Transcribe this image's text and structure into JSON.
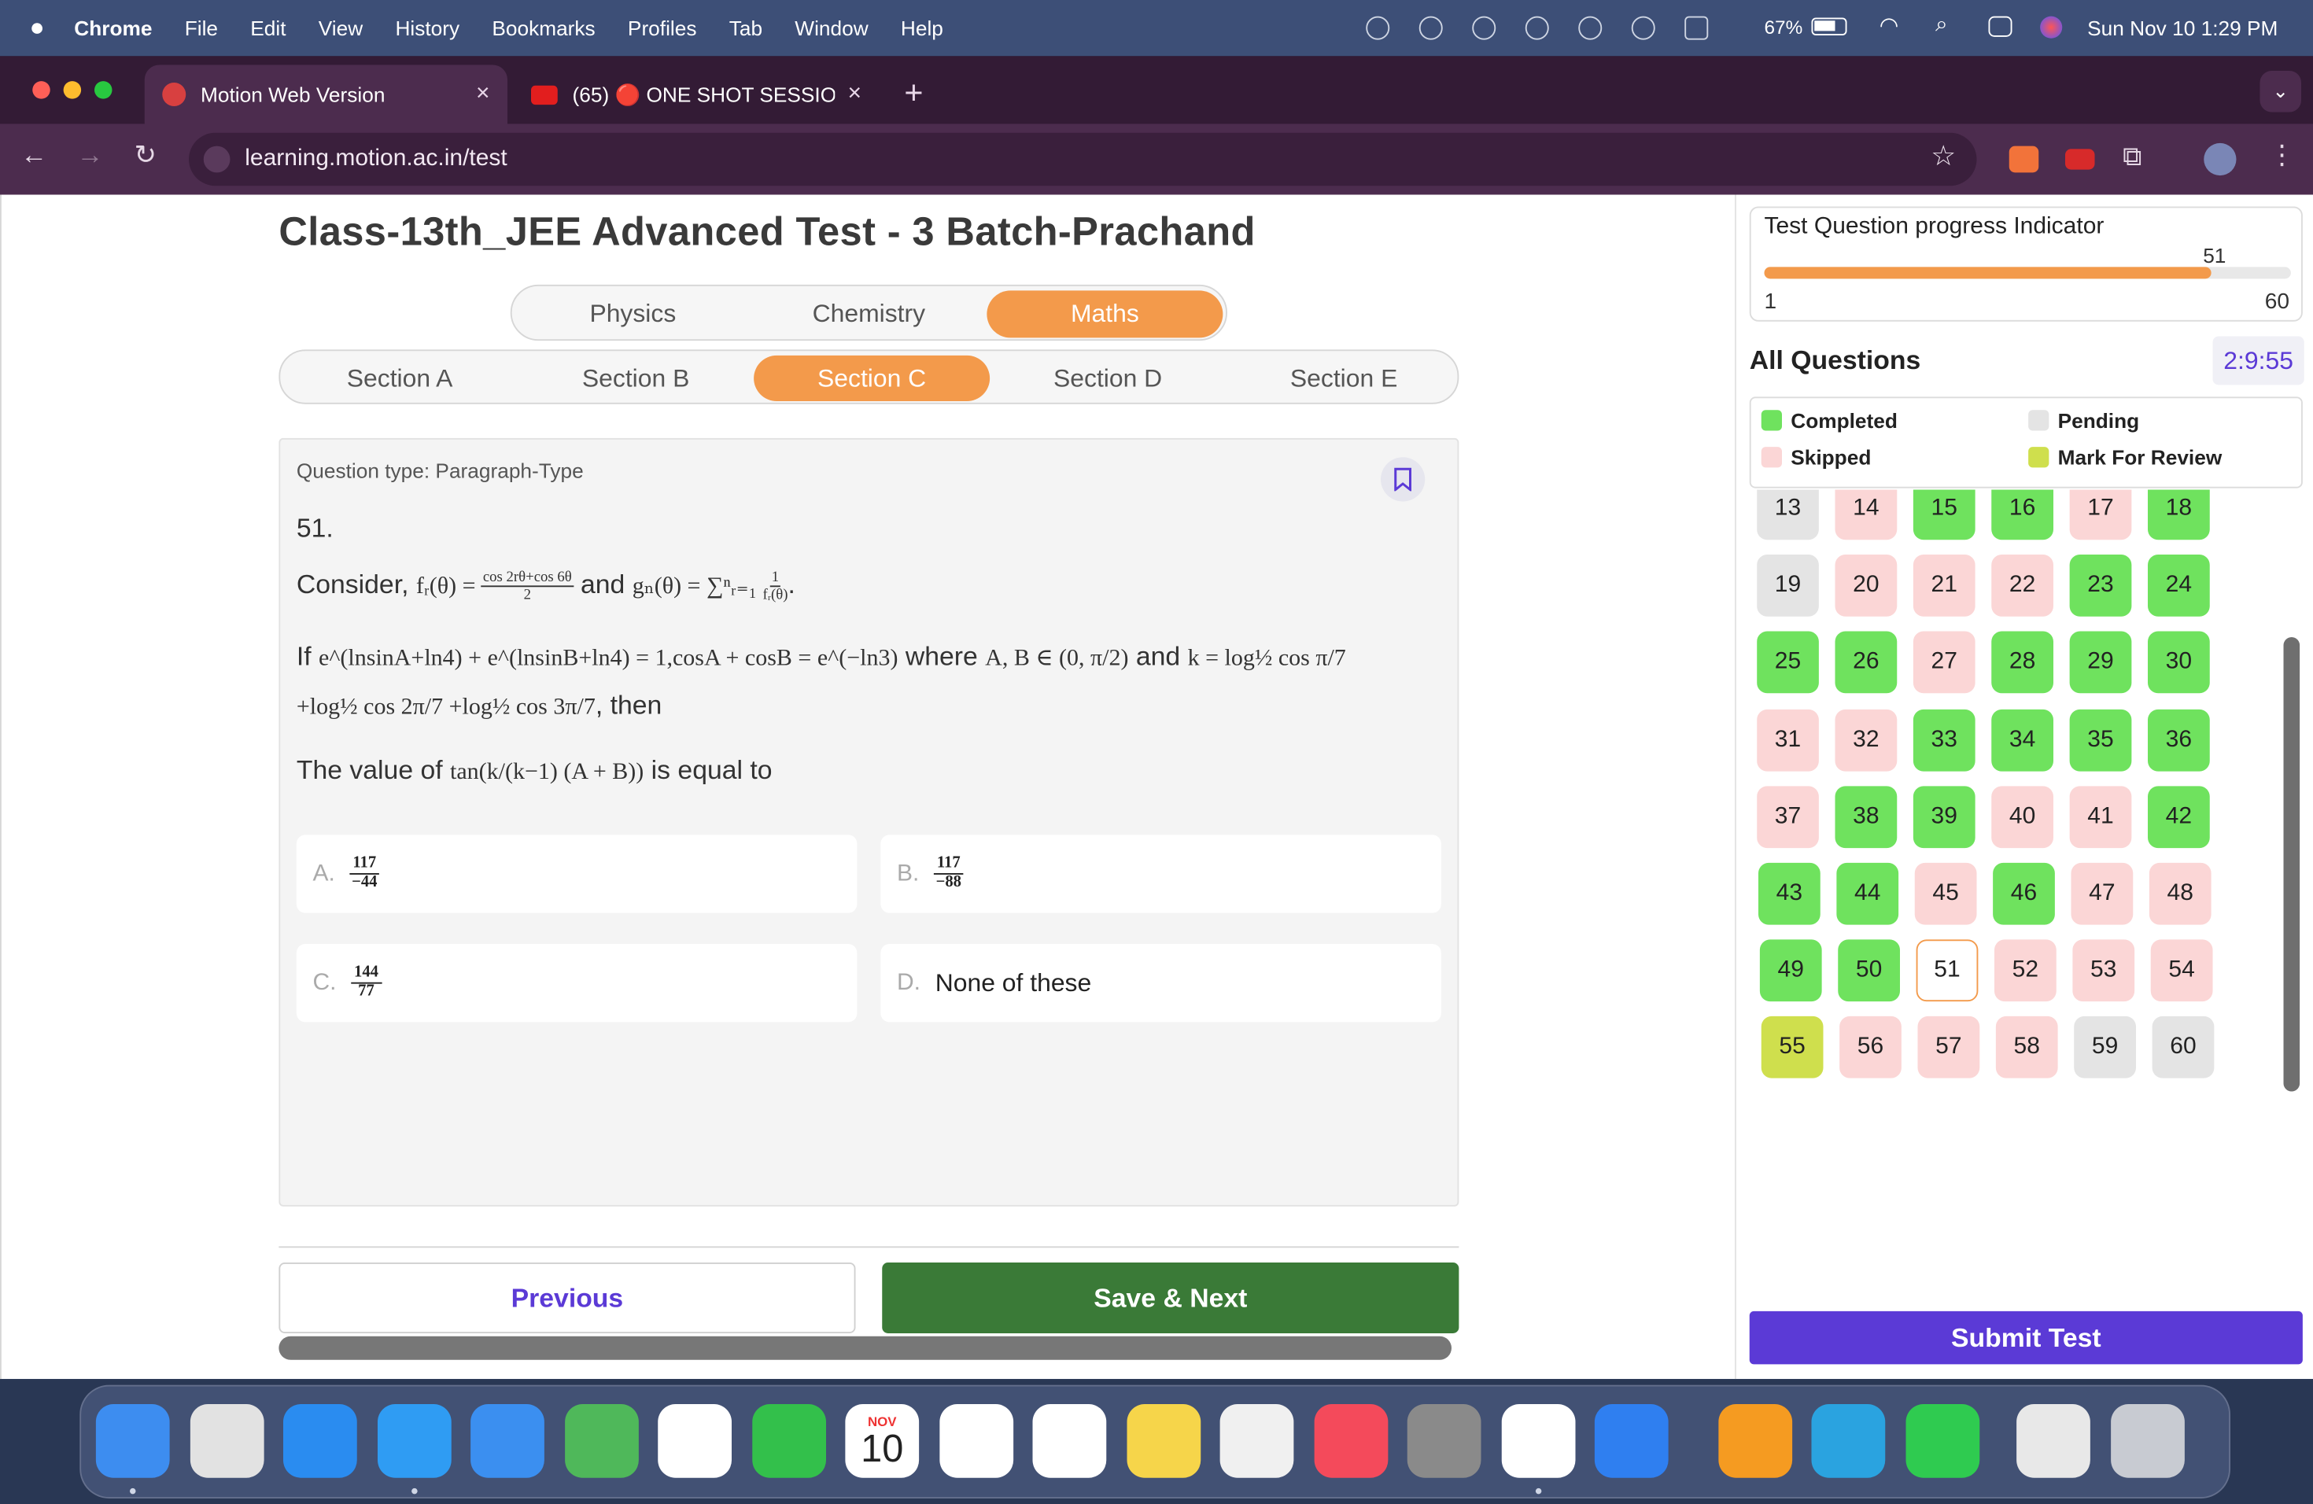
{
  "menubar": {
    "app": "Chrome",
    "items": [
      "File",
      "Edit",
      "View",
      "History",
      "Bookmarks",
      "Profiles",
      "Tab",
      "Window",
      "Help"
    ],
    "battery": "67%",
    "datetime": "Sun Nov 10  1:29 PM"
  },
  "browser": {
    "tabs": [
      {
        "label": "Motion Web Version",
        "active": true
      },
      {
        "label": "(65) 🔴 ONE SHOT SESSION -",
        "active": false
      }
    ],
    "url": "learning.motion.ac.in/test"
  },
  "test": {
    "title": "Class-13th_JEE Advanced Test - 3 Batch-Prachand",
    "subjects": [
      "Physics",
      "Chemistry",
      "Maths"
    ],
    "active_subject": "Maths",
    "sections": [
      "Section A",
      "Section B",
      "Section C",
      "Section D",
      "Section E"
    ],
    "active_section": "Section C",
    "question_type": "Question type: Paragraph-Type",
    "question_number": "51.",
    "question": {
      "line1_prefix": "Consider, ",
      "line1_f": "fᵣ(θ) = ",
      "line1_f_num": "cos 2rθ+cos 6θ",
      "line1_f_den": "2",
      "line1_and": " and ",
      "line1_g": "gₙ(θ) = ∑ⁿᵣ₌₁ ",
      "line1_g_num": "1",
      "line1_g_den": "fᵣ(θ)",
      "line2_if": "If ",
      "line2_math": "e^(lnsinA+ln4) + e^(lnsinB+ln4) = 1,cosA + cosB = e^(−ln3)",
      "line2_where": " where ",
      "line2_interval": "A, B ∈ (0, π/2)",
      "line2_and": " and ",
      "line2_k": "k = log½ cos π/7",
      "line3_math": "+log½ cos 2π/7 +log½ cos 3π/7",
      "line3_then": ", then",
      "line4_prefix": "The value of ",
      "line4_math": "tan(k/(k−1) (A + B))",
      "line4_suffix": " is equal to"
    },
    "options": [
      {
        "letter": "A.",
        "num": "117",
        "den": "−44"
      },
      {
        "letter": "B.",
        "num": "117",
        "den": "−88"
      },
      {
        "letter": "C.",
        "num": "144",
        "den": "77"
      },
      {
        "letter": "D.",
        "text": "None of these"
      }
    ],
    "previous_label": "Previous",
    "next_label": "Save & Next"
  },
  "progress": {
    "title": "Test Question progress Indicator",
    "current": "51",
    "min": "1",
    "max": "60",
    "fraction": 0.85
  },
  "panel": {
    "all_questions": "All Questions",
    "timer": "2:9:55",
    "legend": [
      {
        "label": "Completed",
        "color": "#6fe25e"
      },
      {
        "label": "Pending",
        "color": "#e4e4e4"
      },
      {
        "label": "Skipped",
        "color": "#fbd6d6"
      },
      {
        "label": "Mark For Review",
        "color": "#cfdf4d"
      }
    ],
    "questions": [
      {
        "n": "13",
        "s": "pending"
      },
      {
        "n": "14",
        "s": "skipped"
      },
      {
        "n": "15",
        "s": "completed"
      },
      {
        "n": "16",
        "s": "completed"
      },
      {
        "n": "17",
        "s": "skipped"
      },
      {
        "n": "18",
        "s": "completed"
      },
      {
        "n": "19",
        "s": "pending"
      },
      {
        "n": "20",
        "s": "skipped"
      },
      {
        "n": "21",
        "s": "skipped"
      },
      {
        "n": "22",
        "s": "skipped"
      },
      {
        "n": "23",
        "s": "completed"
      },
      {
        "n": "24",
        "s": "completed"
      },
      {
        "n": "25",
        "s": "completed"
      },
      {
        "n": "26",
        "s": "completed"
      },
      {
        "n": "27",
        "s": "skipped"
      },
      {
        "n": "28",
        "s": "completed"
      },
      {
        "n": "29",
        "s": "completed"
      },
      {
        "n": "30",
        "s": "completed"
      },
      {
        "n": "31",
        "s": "skipped"
      },
      {
        "n": "32",
        "s": "skipped"
      },
      {
        "n": "33",
        "s": "completed"
      },
      {
        "n": "34",
        "s": "completed"
      },
      {
        "n": "35",
        "s": "completed"
      },
      {
        "n": "36",
        "s": "completed"
      },
      {
        "n": "37",
        "s": "skipped"
      },
      {
        "n": "38",
        "s": "completed"
      },
      {
        "n": "39",
        "s": "completed"
      },
      {
        "n": "40",
        "s": "skipped"
      },
      {
        "n": "41",
        "s": "skipped"
      },
      {
        "n": "42",
        "s": "completed"
      },
      {
        "n": "43",
        "s": "completed"
      },
      {
        "n": "44",
        "s": "completed"
      },
      {
        "n": "45",
        "s": "skipped"
      },
      {
        "n": "46",
        "s": "completed"
      },
      {
        "n": "47",
        "s": "skipped"
      },
      {
        "n": "48",
        "s": "skipped"
      },
      {
        "n": "49",
        "s": "completed"
      },
      {
        "n": "50",
        "s": "completed"
      },
      {
        "n": "51",
        "s": "current"
      },
      {
        "n": "52",
        "s": "skipped"
      },
      {
        "n": "53",
        "s": "skipped"
      },
      {
        "n": "54",
        "s": "skipped"
      },
      {
        "n": "55",
        "s": "review"
      },
      {
        "n": "56",
        "s": "skipped"
      },
      {
        "n": "57",
        "s": "skipped"
      },
      {
        "n": "58",
        "s": "skipped"
      },
      {
        "n": "59",
        "s": "pending"
      },
      {
        "n": "60",
        "s": "pending"
      }
    ],
    "submit_label": "Submit Test"
  },
  "dock": {
    "calendar_month": "NOV",
    "calendar_day": "10",
    "apps": [
      "finder-icon",
      "launchpad-icon",
      "app-store-icon",
      "safari-icon",
      "mail-icon",
      "maps-icon",
      "photos-icon",
      "facetime-icon",
      "calendar-icon",
      "reminders-icon",
      "freeform-icon",
      "notes-icon",
      "screenshot-icon",
      "music-icon",
      "system-settings-icon",
      "chrome-icon",
      "bookmark-app-icon",
      "infuse-icon",
      "telegram-icon",
      "whatsapp-icon",
      "document-preview-icon",
      "trash-icon"
    ]
  }
}
